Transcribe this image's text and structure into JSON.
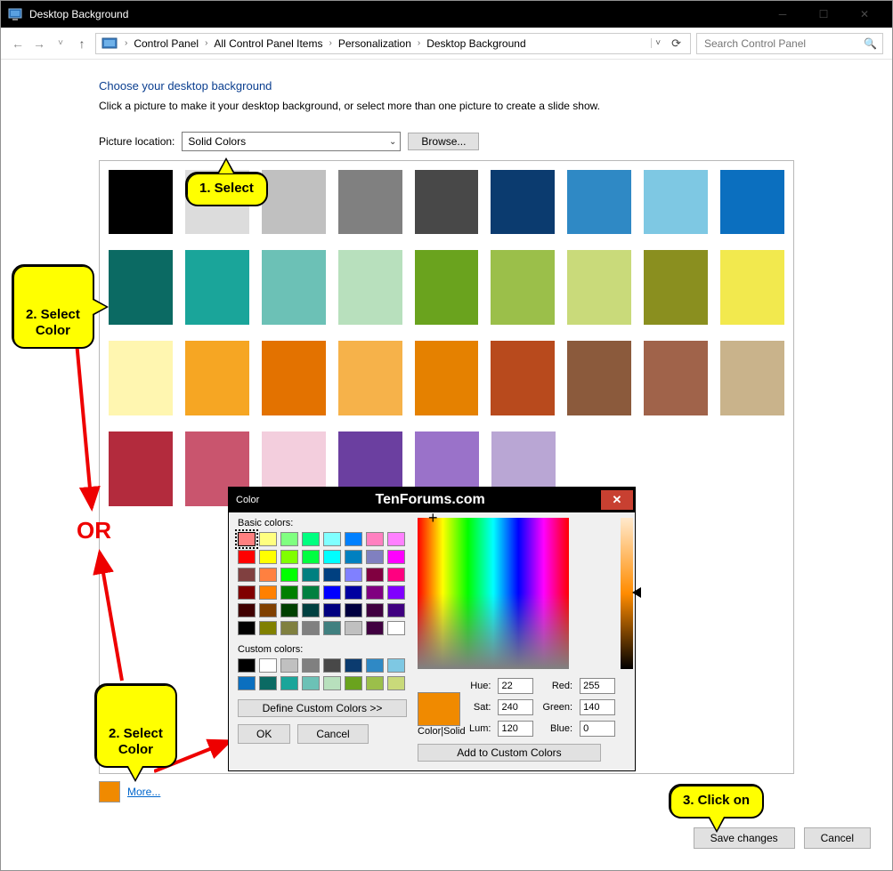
{
  "window": {
    "title": "Desktop Background"
  },
  "breadcrumbs": {
    "items": [
      "Control Panel",
      "All Control Panel Items",
      "Personalization",
      "Desktop Background"
    ]
  },
  "search": {
    "placeholder": "Search Control Panel"
  },
  "page": {
    "heading": "Choose your desktop background",
    "subtext": "Click a picture to make it your desktop background, or select more than one picture to create a slide show.",
    "picloc_label": "Picture location:",
    "picloc_value": "Solid Colors",
    "browse_label": "Browse...",
    "more_label": "More...",
    "save_label": "Save changes",
    "cancel_label": "Cancel"
  },
  "colors": {
    "row1": [
      "#000000",
      "#dcdcdc",
      "#c0c0c0",
      "#808080",
      "#484848",
      "#0b3b6f",
      "#2f89c5",
      "#7ec8e3",
      "#0b6fbf"
    ],
    "row2": [
      "#0b6a63",
      "#1aa59a",
      "#6cc1b6",
      "#b8e0bd",
      "#6aa31e",
      "#9bbf4a",
      "#c9da7a",
      "#8a8f1f",
      "#f2e94e"
    ],
    "row3": [
      "#fff6b0",
      "#f6a623",
      "#e37200",
      "#f6b24a",
      "#e58100",
      "#b84a1d",
      "#8b5a3c",
      "#a0634a",
      "#c9b38b"
    ],
    "row4": [
      "#b32b3d",
      "#c9556e",
      "#f3cedd",
      "#6b3fa0",
      "#9a72c9",
      "#b9a6d4"
    ]
  },
  "callouts": {
    "c1": "1. Select",
    "c2": "2. Select\nColor",
    "c3": "2. Select\nColor",
    "c4": "3. Click on",
    "or": "OR"
  },
  "dialog": {
    "title_label": "Color",
    "heading": "TenForums.com",
    "basic_label": "Basic colors:",
    "custom_label": "Custom colors:",
    "define_label": "Define Custom Colors >>",
    "ok_label": "OK",
    "cancel_label": "Cancel",
    "colsolid_label": "Color|Solid",
    "add_label": "Add to Custom Colors",
    "hue_label": "Hue:",
    "sat_label": "Sat:",
    "lum_label": "Lum:",
    "red_label": "Red:",
    "green_label": "Green:",
    "blue_label": "Blue:",
    "hue": "22",
    "sat": "240",
    "lum": "120",
    "red": "255",
    "green": "140",
    "blue": "0",
    "basic_colors": [
      "#ff8080",
      "#ffff80",
      "#80ff80",
      "#00ff80",
      "#80ffff",
      "#0080ff",
      "#ff80c0",
      "#ff80ff",
      "#ff0000",
      "#ffff00",
      "#80ff00",
      "#00ff40",
      "#00ffff",
      "#0080c0",
      "#8080c0",
      "#ff00ff",
      "#804040",
      "#ff8040",
      "#00ff00",
      "#008080",
      "#004080",
      "#8080ff",
      "#800040",
      "#ff0080",
      "#800000",
      "#ff8000",
      "#008000",
      "#008040",
      "#0000ff",
      "#0000a0",
      "#800080",
      "#8000ff",
      "#400000",
      "#804000",
      "#004000",
      "#004040",
      "#000080",
      "#000040",
      "#400040",
      "#400080",
      "#000000",
      "#808000",
      "#808040",
      "#808080",
      "#408080",
      "#c0c0c0",
      "#400040",
      "#ffffff"
    ],
    "custom_colors": [
      "#000000",
      "#ffffff",
      "#c0c0c0",
      "#808080",
      "#484848",
      "#0b3b6f",
      "#2f89c5",
      "#7ec8e3",
      "#0b6fbf",
      "#0b6a63",
      "#1aa59a",
      "#6cc1b6",
      "#b8e0bd",
      "#6aa31e",
      "#9bbf4a",
      "#c9da7a"
    ]
  }
}
